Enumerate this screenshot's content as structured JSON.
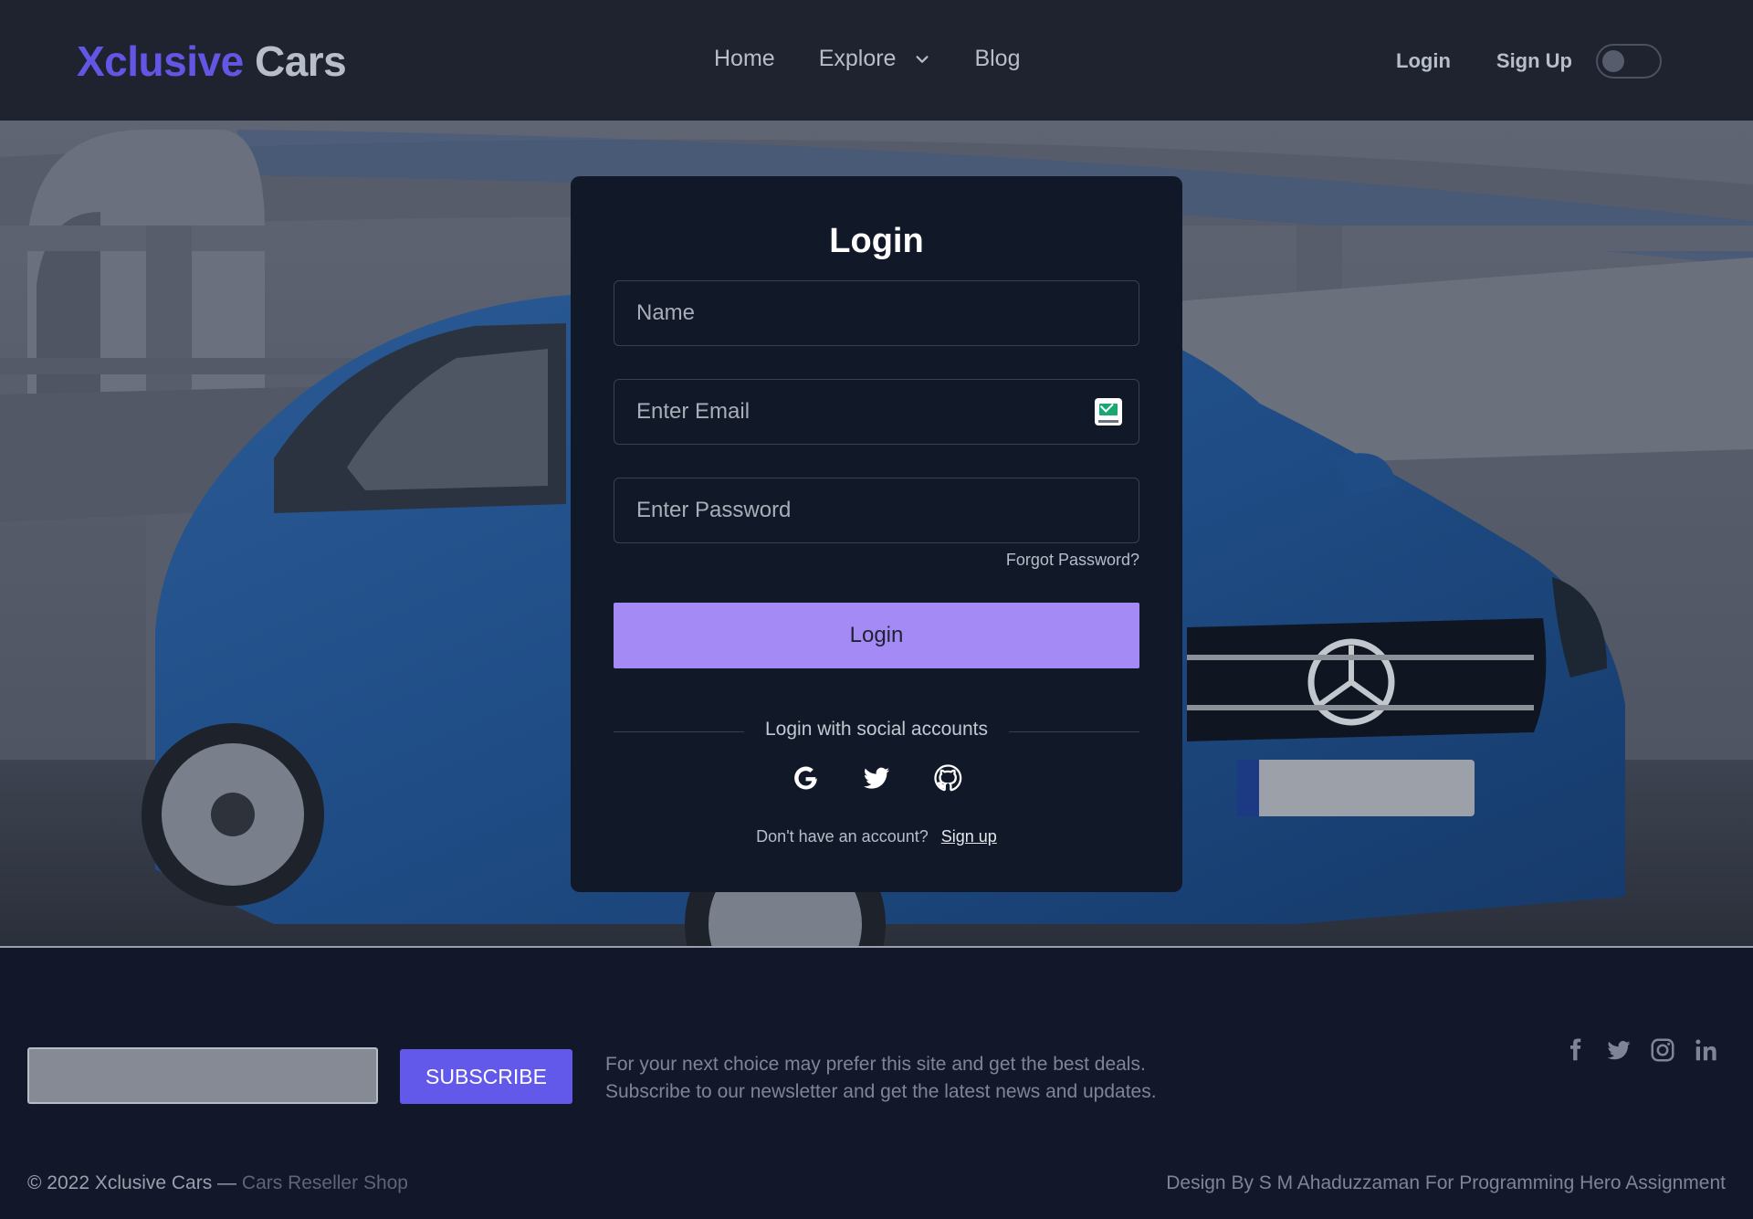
{
  "brand": {
    "part1": "Xclusive",
    "part2": "Cars"
  },
  "nav": {
    "home": "Home",
    "explore": "Explore",
    "blog": "Blog"
  },
  "auth": {
    "login": "Login",
    "signup": "Sign Up",
    "theme_toggle": "off"
  },
  "login_card": {
    "title": "Login",
    "name_placeholder": "Name",
    "email_placeholder": "Enter Email",
    "password_placeholder": "Enter Password",
    "forgot": "Forgot Password?",
    "submit": "Login",
    "social_label": "Login with social accounts",
    "social_icons": [
      "google-icon",
      "twitter-icon",
      "github-icon"
    ],
    "no_account": "Don't have an account?",
    "signup_link": "Sign up"
  },
  "footer": {
    "subscribe_button": "SUBSCRIBE",
    "newsletter_line1": "For your next choice may prefer this site and get the best deals.",
    "newsletter_line2": "Subscribe to our newsletter and get the latest news and updates.",
    "social_icons": [
      "facebook-icon",
      "twitter-icon",
      "instagram-icon",
      "linkedin-icon"
    ],
    "copyright": "© 2022 Xclusive Cars —",
    "copyright_sub": "Cars Reseller Shop",
    "credit": "Design By S M Ahaduzzaman For Programming Hero Assignment"
  },
  "colors": {
    "accent": "#6356e5",
    "login_button": "#a48af5",
    "subscribe_button": "#6259ea",
    "background": "#111827",
    "header": "#1f2330"
  }
}
